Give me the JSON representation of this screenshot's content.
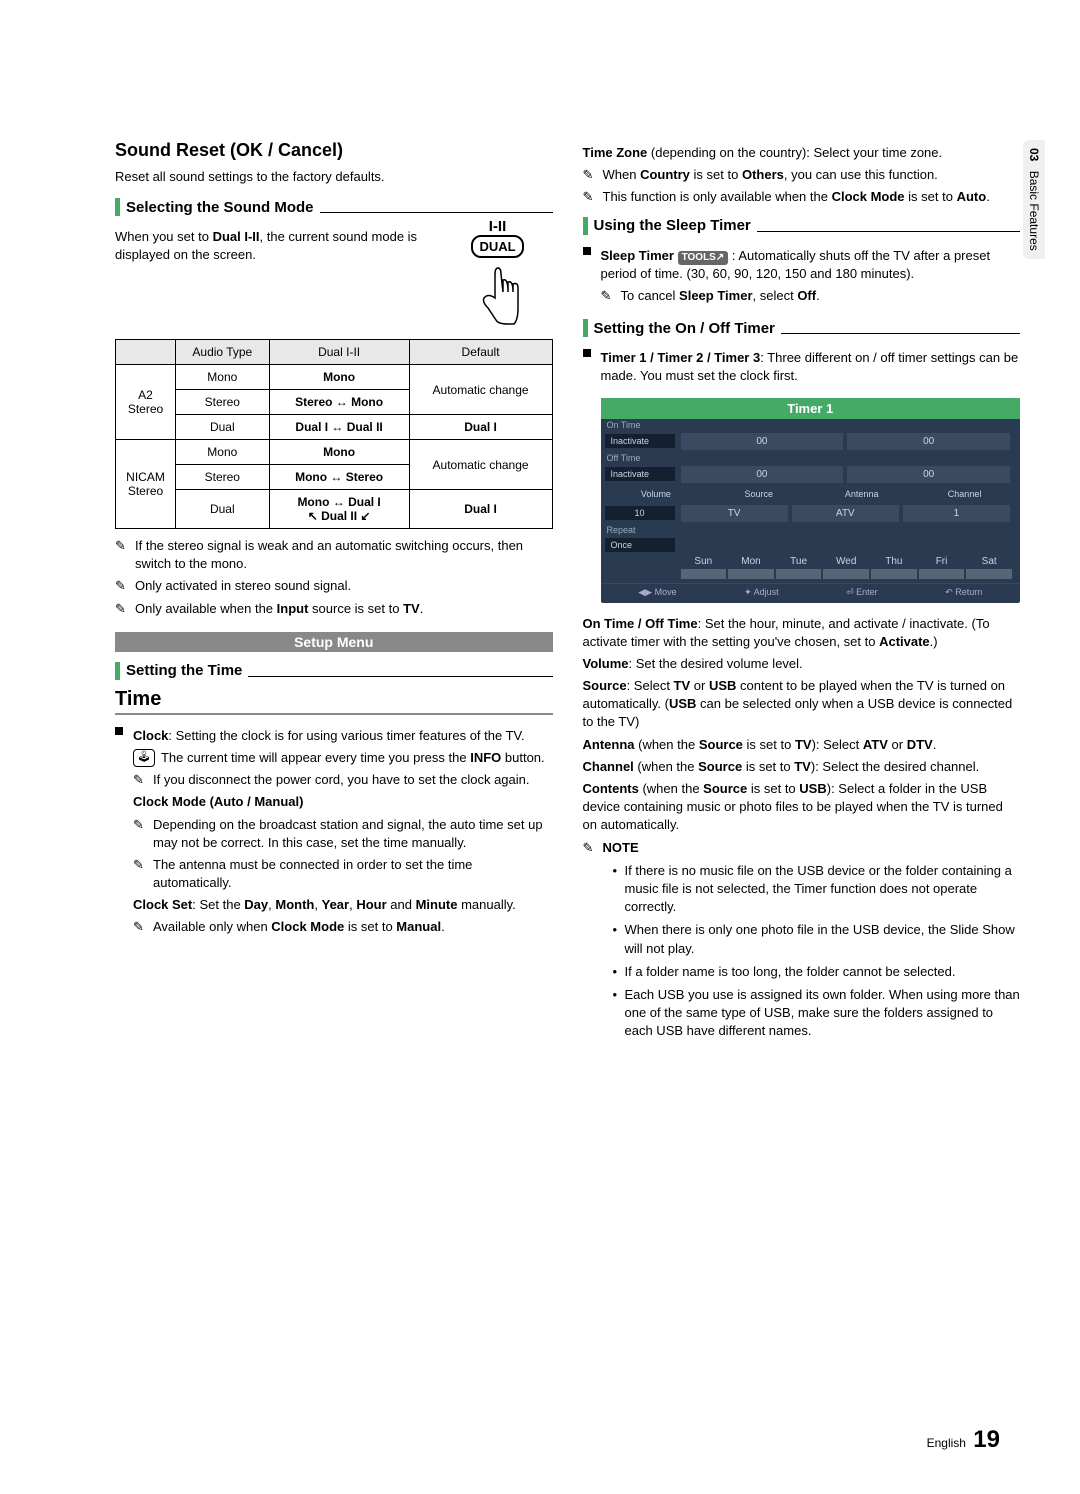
{
  "sideTab": {
    "num": "03",
    "label": "Basic Features"
  },
  "left": {
    "h_soundReset": "Sound Reset (OK / Cancel)",
    "p_soundReset": "Reset all sound settings to the factory defaults.",
    "h_selectMode": "Selecting the Sound Mode",
    "p_selectMode_pre": "When you set to ",
    "p_selectMode_b": "Dual I-II",
    "p_selectMode_post": ", the current sound mode is displayed on the screen.",
    "remote_top": "I-II",
    "remote_box": "DUAL",
    "table": {
      "headers": {
        "audioType": "Audio Type",
        "dual": "Dual I-II",
        "default": "Default"
      },
      "a2Label": "A2 Stereo",
      "a2": {
        "mono": {
          "t": "Mono",
          "d": "Mono",
          "def": "Automatic change"
        },
        "stereo": {
          "t": "Stereo",
          "d": "Stereo ↔ Mono"
        },
        "dual": {
          "t": "Dual",
          "d": "Dual I ↔ Dual II",
          "def": "Dual I"
        }
      },
      "nicamLabel": "NICAM Stereo",
      "nicam": {
        "mono": {
          "t": "Mono",
          "d": "Mono",
          "def": "Automatic change"
        },
        "stereo": {
          "t": "Stereo",
          "d": "Mono ↔ Stereo"
        },
        "dual": {
          "t": "Dual",
          "d1": "Mono ↔ Dual I",
          "d2": "↖ Dual II ↙",
          "def": "Dual I"
        }
      }
    },
    "note1": "If the stereo signal is weak and an automatic switching occurs, then switch to the mono.",
    "note2": "Only activated in stereo sound signal.",
    "note3_pre": "Only available when the ",
    "note3_b": "Input",
    "note3_post": " source is set to ",
    "note3_b2": "TV",
    "note3_end": ".",
    "banner": "Setup Menu",
    "h_settingTime": "Setting the Time",
    "h_time": "Time",
    "clock_b": "Clock",
    "clock_txt": ": Setting the clock is for using various timer features of the TV.",
    "clock_n1_pre": "The current time will appear every time you press the ",
    "clock_n1_b": "INFO",
    "clock_n1_post": " button.",
    "clock_n2": "If you disconnect the power cord, you have to set the clock again.",
    "clockMode_b": "Clock Mode (Auto / Manual)",
    "clockMode_n1": "Depending on the broadcast station and signal, the auto time set up may not be correct. In this case, set the time manually.",
    "clockMode_n2": "The antenna must be connected in order to set the time automatically.",
    "clockSet_b": "Clock Set",
    "clockSet_txt": ": Set the ",
    "cs1": "Day",
    "cs2": "Month",
    "cs3": "Year",
    "cs4": "Hour",
    "cs_and": " and ",
    "cs5": "Minute",
    "clockSet_end": " manually.",
    "clockSet_n1_pre": "Available only when ",
    "clockSet_n1_b": "Clock Mode",
    "clockSet_n1_post": " is set to ",
    "clockSet_n1_b2": "Manual",
    "clockSet_n1_end": "."
  },
  "right": {
    "tz_b": "Time Zone",
    "tz_txt": " (depending on the country): Select your time zone.",
    "tz_n1_pre": "When ",
    "tz_n1_b": "Country",
    "tz_n1_mid": " is set to ",
    "tz_n1_b2": "Others",
    "tz_n1_post": ", you can use this function.",
    "tz_n2_pre": "This function is only available when the ",
    "tz_n2_b": "Clock Mode",
    "tz_n2_mid": " is set to ",
    "tz_n2_b2": "Auto",
    "tz_n2_end": ".",
    "h_sleep": "Using the Sleep Timer",
    "sleep_b": "Sleep Timer",
    "sleep_tool": "TOOLS↗",
    "sleep_txt": " : Automatically shuts off the TV after a preset period of time. (30, 60, 90, 120, 150 and 180 minutes).",
    "sleep_n1_pre": "To cancel ",
    "sleep_n1_b": "Sleep Timer",
    "sleep_n1_mid": ", select ",
    "sleep_n1_b2": "Off",
    "sleep_n1_end": ".",
    "h_onoff": "Setting the On / Off Timer",
    "onoff_b": "Timer 1 / Timer 2 / Timer 3",
    "onoff_txt": ": Three different on / off timer settings can be made. You must set the clock first.",
    "panel": {
      "title": "Timer 1",
      "onTime": "On Time",
      "offTime": "Off Time",
      "inactivate": "Inactivate",
      "zz": "00",
      "volume": "Volume",
      "source": "Source",
      "antenna": "Antenna",
      "channel": "Channel",
      "v10": "10",
      "vTV": "TV",
      "vATV": "ATV",
      "v1": "1",
      "repeat": "Repeat",
      "once": "Once",
      "days": [
        "Sun",
        "Mon",
        "Tue",
        "Wed",
        "Thu",
        "Fri",
        "Sat"
      ],
      "footer": {
        "move": "◀▶ Move",
        "adjust": "✦ Adjust",
        "enter": "⏎ Enter",
        "return": "↶ Return"
      }
    },
    "p_onoff_b": "On Time / Off Time",
    "p_onoff": ": Set the hour, minute, and activate / inactivate. (To activate timer with the setting you've chosen, set to ",
    "p_onoff_b2": "Activate",
    "p_onoff_end": ".)",
    "p_vol_b": "Volume",
    "p_vol": ": Set the desired volume level.",
    "p_src_b": "Source",
    "p_src_1": ": Select ",
    "p_src_b2": "TV",
    "p_src_2": " or ",
    "p_src_b3": "USB",
    "p_src_3": " content to be played when the TV is turned on automatically. (",
    "p_src_b4": "USB",
    "p_src_4": " can be selected only when a USB device is connected to the TV)",
    "p_ant_b": "Antenna",
    "p_ant_1": " (when the ",
    "p_ant_b2": "Source",
    "p_ant_2": " is set to ",
    "p_ant_b3": "TV",
    "p_ant_3": "): Select ",
    "p_ant_b4": "ATV",
    "p_ant_4": " or ",
    "p_ant_b5": "DTV",
    "p_ant_end": ".",
    "p_ch_b": "Channel",
    "p_ch_1": " (when the ",
    "p_ch_b2": "Source",
    "p_ch_2": " is set to ",
    "p_ch_b3": "TV",
    "p_ch_3": "): Select the desired channel.",
    "p_cnt_b": "Contents",
    "p_cnt_1": " (when the ",
    "p_cnt_b2": "Source",
    "p_cnt_2": " is set to ",
    "p_cnt_b3": "USB",
    "p_cnt_3": "): Select a folder in the USB device containing music or photo files to be played when the TV is turned on automatically.",
    "noteHeader": "NOTE",
    "notes": [
      "If there is no music file on the USB device or the folder containing a music file is not selected, the Timer function does not operate correctly.",
      "When there is only one photo file in the USB device, the Slide Show will not play.",
      "If a folder name is too long, the folder cannot be selected.",
      "Each USB you use is assigned its own folder. When using more than one of the same type of USB, make sure the folders assigned to each USB have different names."
    ]
  },
  "footer": {
    "lang": "English",
    "page": "19"
  }
}
